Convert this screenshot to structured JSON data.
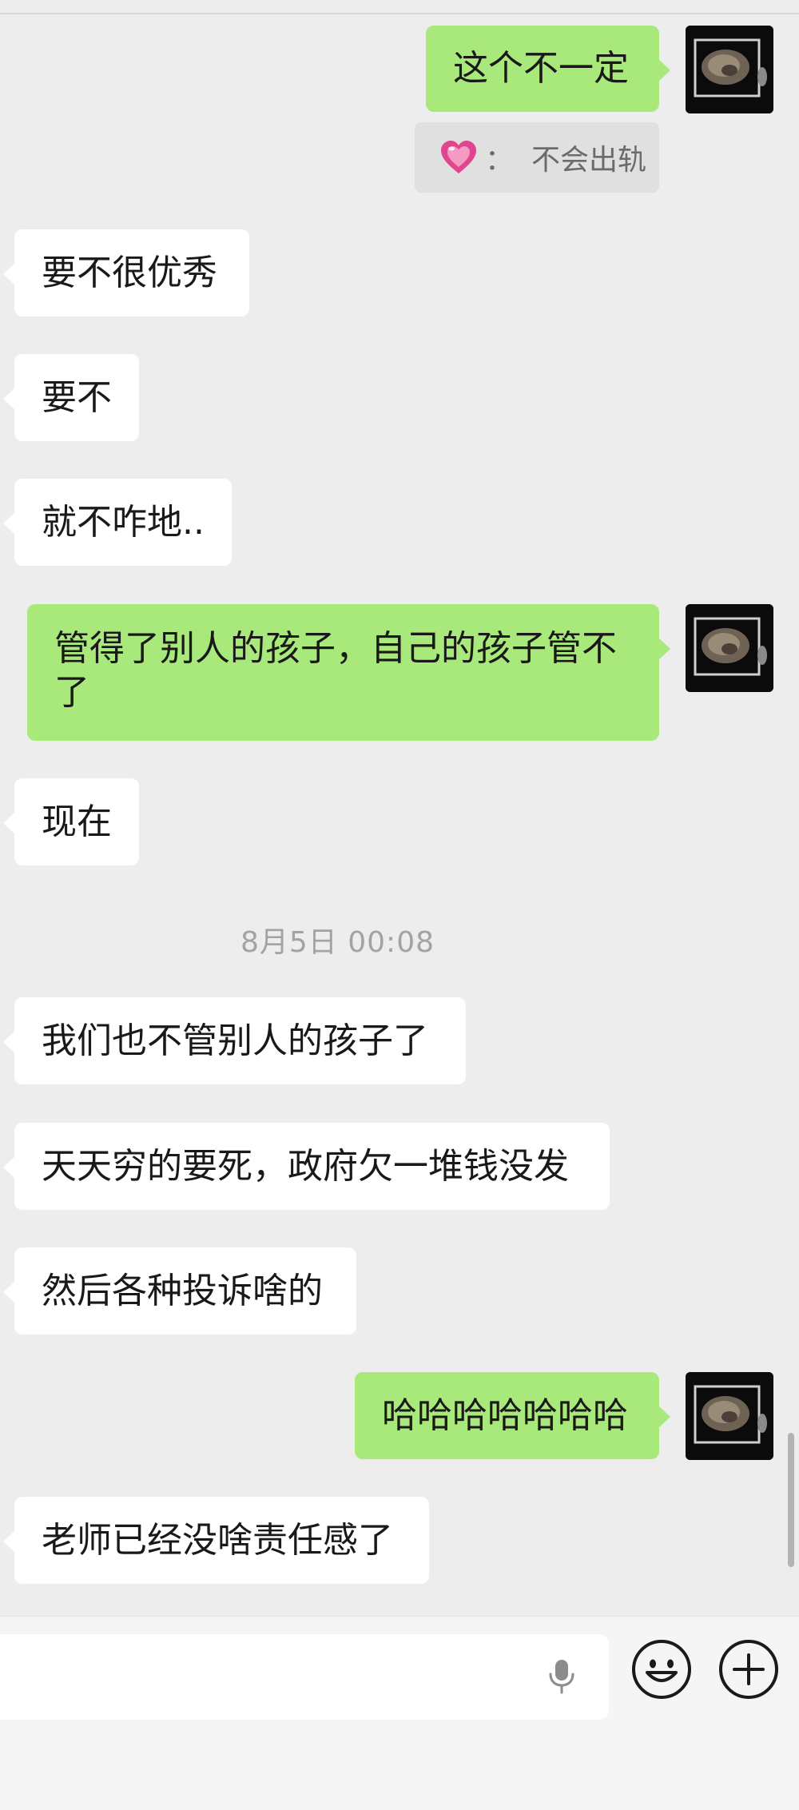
{
  "messages": [
    {
      "side": "out",
      "text": "这个不一定"
    },
    {
      "side": "in",
      "text": "要不很优秀"
    },
    {
      "side": "in",
      "text": "要不"
    },
    {
      "side": "in",
      "text": "就不咋地.."
    },
    {
      "side": "out",
      "line1": "管得了别人的孩子，自己的孩子管不",
      "line2": "了"
    },
    {
      "side": "in",
      "text": "现在"
    },
    {
      "side": "in",
      "text": "我们也不管别人的孩子了"
    },
    {
      "side": "in",
      "text": "天天穷的要死，政府欠一堆钱没发"
    },
    {
      "side": "in",
      "text": "然后各种投诉啥的"
    },
    {
      "side": "out",
      "text": "哈哈哈哈哈哈哈"
    },
    {
      "side": "in",
      "text": "老师已经没啥责任感了"
    }
  ],
  "reaction": {
    "icon": "pink-heart-icon",
    "separator": "：",
    "text": "不会出轨"
  },
  "timestamp": "8月5日 00:08",
  "colors": {
    "background": "#ededed",
    "incoming_bubble": "#ffffff",
    "outgoing_bubble": "#a9e97c",
    "timestamp": "#a3a3a3"
  },
  "input_bar": {
    "icons": [
      "microphone-icon",
      "emoji-icon",
      "plus-icon"
    ]
  }
}
